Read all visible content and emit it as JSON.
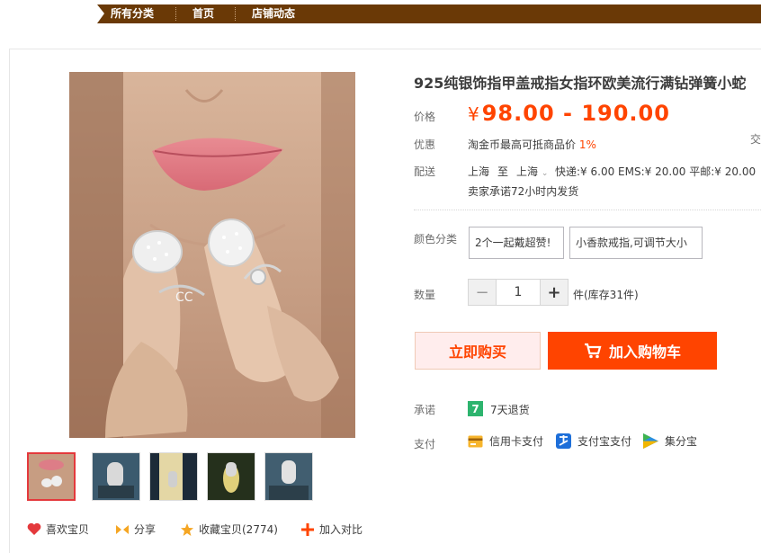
{
  "nav": {
    "items": [
      "所有分类",
      "首页",
      "店铺动态"
    ]
  },
  "product": {
    "title": "925纯银饰指甲盖戒指女指环欧美流行满钻弹簧小蛇",
    "price_label": "价格",
    "price_currency": "¥",
    "price_range": "98.00 - 190.00",
    "promo_label": "优惠",
    "promo_text": "淘金币最高可抵商品价",
    "promo_rate": "1%",
    "side_truncated": "交",
    "shipping_label": "配送",
    "ship_from": "上海",
    "ship_to_word": "至",
    "ship_to": "上海",
    "shipping_methods": "快递:¥ 6.00  EMS:¥ 20.00  平邮:¥ 20.00",
    "ship_promise": "卖家承诺72小时内发货",
    "sku_label": "颜色分类",
    "sku_options": [
      "2个一起戴超赞!",
      "小香款戒指,可调节大小"
    ],
    "qty_label": "数量",
    "qty_minus": "−",
    "qty_value": "1",
    "qty_plus": "+",
    "qty_unit_stock": "件(库存31件)",
    "buy_now": "立即购买",
    "add_to_cart": "加入购物车",
    "promise_label": "承诺",
    "promise_icon_text": "7",
    "promise_text": "7天退货",
    "payment_label": "支付",
    "payments": [
      "信用卡支付",
      "支付宝支付",
      "集分宝"
    ]
  },
  "actions": {
    "favorite": "喜欢宝贝",
    "share": "分享",
    "collect": "收藏宝贝(2774)",
    "compare": "加入对比"
  },
  "colors": {
    "nav_bg": "#6a3906",
    "price": "#ff4400",
    "cart_bg": "#ff4400",
    "buy_bg": "#ffeded",
    "promise_green": "#2db46e"
  },
  "icons": [
    "heart-icon",
    "share-icon",
    "star-icon",
    "plus-icon",
    "cart-icon",
    "credit-card-icon",
    "alipay-icon",
    "jifenbao-icon"
  ]
}
